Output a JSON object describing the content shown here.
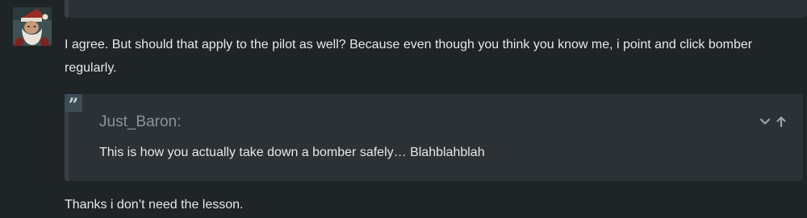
{
  "post": {
    "avatar_icon": "user-avatar-santa-portrait",
    "paragraph_1": "I agree. But should that apply to the pilot as well? Because even though you think you know me, i point and click bomber regularly.",
    "quote": {
      "quote_icon": "quote-mark-icon",
      "author": "Just_Baron:",
      "body": "This is how you actually take down a bomber safely… Blahblahblah",
      "expand_icon": "chevron-down-icon",
      "jump_icon": "arrow-up-icon"
    },
    "paragraph_2": "Thanks i don’t need the lesson."
  },
  "colors": {
    "background": "#1f2427",
    "quote_background": "#2b3135",
    "text": "#e7e8e9",
    "muted_text": "#8b959c"
  }
}
